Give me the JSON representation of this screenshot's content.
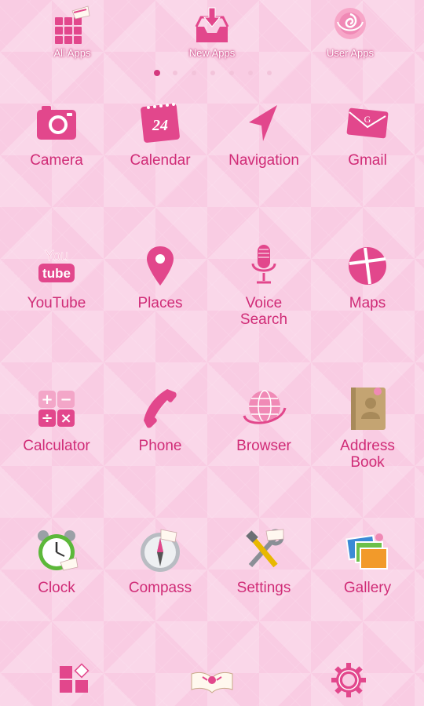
{
  "top_tabs": [
    {
      "label": "All Apps",
      "icon": "grid-icon"
    },
    {
      "label": "New Apps",
      "icon": "inbox-download-icon"
    },
    {
      "label": "User Apps",
      "icon": "rose-icon"
    }
  ],
  "pager": {
    "pages": 7,
    "current": 1
  },
  "apps": [
    {
      "label": "Camera",
      "icon": "camera-icon"
    },
    {
      "label": "Calendar",
      "icon": "calendar-icon",
      "day": "24"
    },
    {
      "label": "Navigation",
      "icon": "navigation-arrow-icon"
    },
    {
      "label": "Gmail",
      "icon": "mail-icon",
      "glyph": "G"
    },
    {
      "label": "YouTube",
      "icon": "youtube-icon",
      "logo_top": "You",
      "logo_bottom": "tube"
    },
    {
      "label": "Places",
      "icon": "map-pin-icon"
    },
    {
      "label": "Voice\nSearch",
      "line1": "Voice",
      "line2": "Search",
      "icon": "microphone-icon"
    },
    {
      "label": "Maps",
      "icon": "map-icon"
    },
    {
      "label": "Calculator",
      "icon": "calculator-icon",
      "keys": [
        "+",
        "−",
        "÷",
        "×"
      ]
    },
    {
      "label": "Phone",
      "icon": "phone-handset-icon"
    },
    {
      "label": "Browser",
      "icon": "globe-icon"
    },
    {
      "label": "Address\nBook",
      "line1": "Address",
      "line2": "Book",
      "icon": "address-book-icon"
    },
    {
      "label": "Clock",
      "icon": "alarm-clock-icon"
    },
    {
      "label": "Compass",
      "icon": "compass-icon"
    },
    {
      "label": "Settings",
      "icon": "tools-icon"
    },
    {
      "label": "Gallery",
      "icon": "photos-icon"
    }
  ],
  "dock": [
    {
      "icon": "apps-grid-icon"
    },
    {
      "icon": "book-icon"
    },
    {
      "icon": "gear-icon"
    }
  ],
  "colors": {
    "label": "#d02c77",
    "accent": "#e0508f",
    "background": "#f9cce3"
  }
}
